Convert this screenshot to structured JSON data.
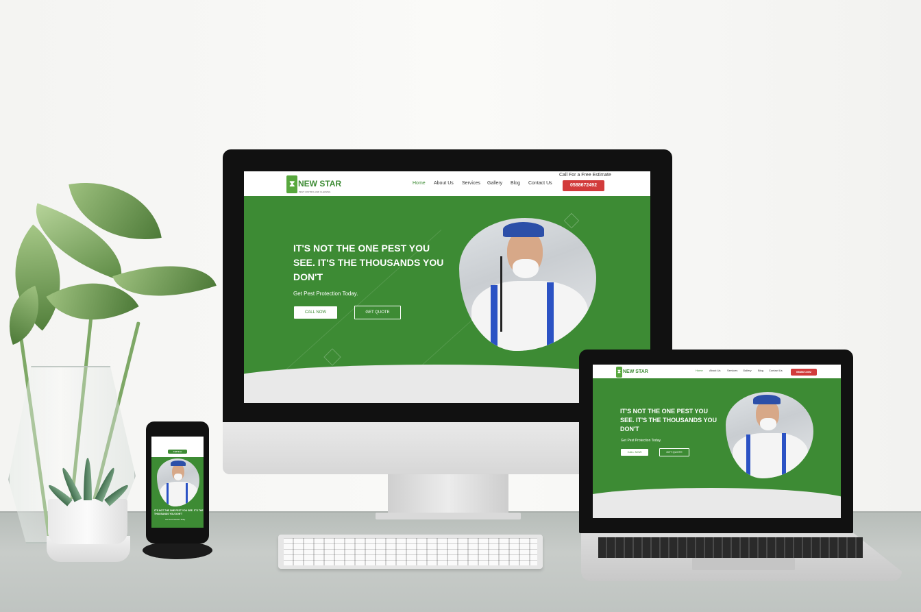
{
  "site": {
    "brand": {
      "name": "NEW STAR",
      "tagline": "PEST CONTROL AND CLEANING"
    },
    "nav": [
      "Home",
      "About Us",
      "Services",
      "Gallery",
      "Blog",
      "Contact Us"
    ],
    "nav_active": "Home",
    "estimate_label": "Call For a Free Estimate",
    "phone": "0588672492",
    "hero": {
      "headline": "IT'S NOT THE ONE PEST YOU SEE. IT'S THE THOUSANDS YOU DON'T",
      "subheadline": "Get Pest Protection Today.",
      "call_button": "CALL NOW",
      "quote_button": "GET QUOTE"
    },
    "phone_nav_label": "Call Now"
  },
  "colors": {
    "brand_green": "#3d8b34",
    "phone_red": "#d23b3b",
    "hero_bottom": "#e9e9e9"
  },
  "devices": [
    "desktop-monitor",
    "laptop",
    "smartphone"
  ]
}
